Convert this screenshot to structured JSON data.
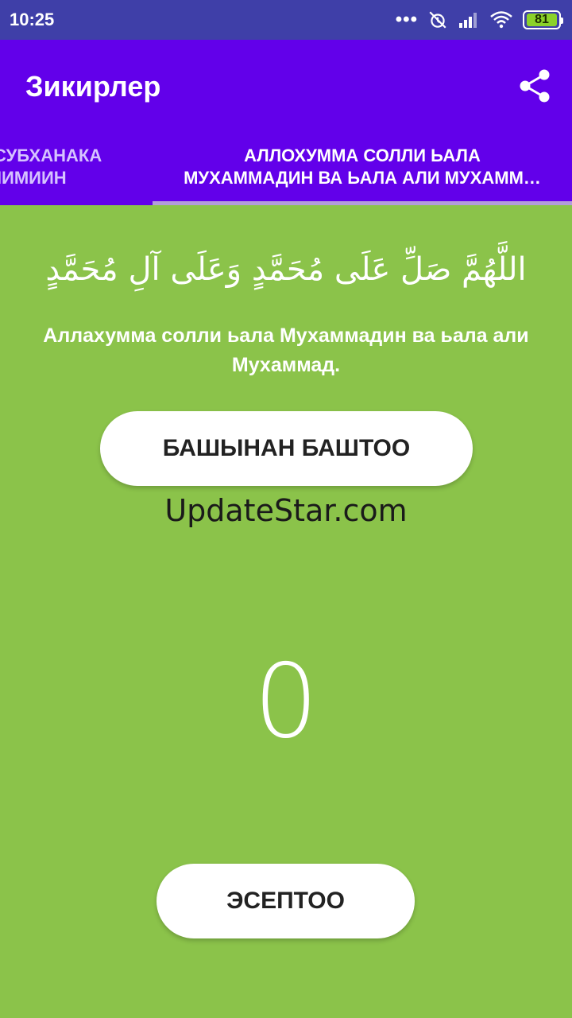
{
  "status_bar": {
    "time": "10:25",
    "dots": "•••",
    "battery": "81"
  },
  "app_bar": {
    "title": "Зикирлер"
  },
  "tabs": [
    {
      "line1": "А СУБХАНАКА",
      "line2": "ОЛИМИИН",
      "active": false
    },
    {
      "line1": "АЛЛОХУММА СОЛЛИ ЬАЛА",
      "line2": "МУХАММАДИН ВА ЬАЛА АЛИ МУХАММ…",
      "active": true
    }
  ],
  "content": {
    "arabic": "اللَّهُمَّ صَلِّ عَلَى مُحَمَّدٍ وَعَلَى آلِ مُحَمَّدٍ",
    "transliteration": "Аллахумма солли ьала Мухаммадин ва ьала али Мухаммад.",
    "restart_label": "БАШЫНАН БАШТОО",
    "watermark": "UpdateStar.com",
    "counter": "0",
    "count_label": "ЭСЕПТОО"
  },
  "colors": {
    "status_bar": "#3f3fa8",
    "app_bar": "#6200ea",
    "background": "#8bc34a",
    "tab_indicator": "#b39ddb"
  }
}
